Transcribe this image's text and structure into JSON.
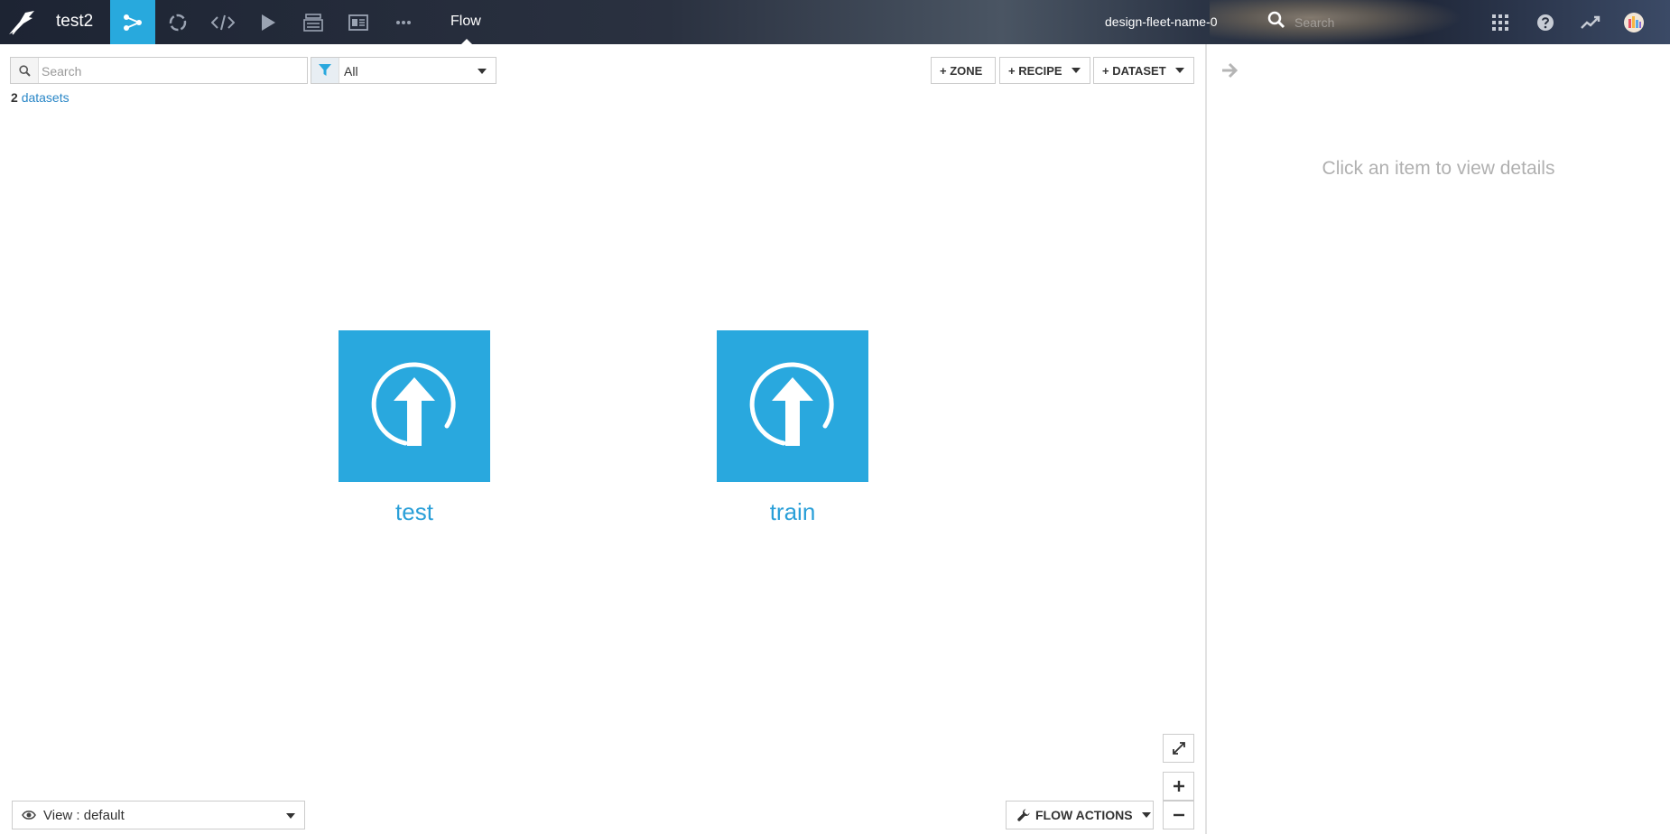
{
  "topbar": {
    "project_name": "test2",
    "current_section": "Flow",
    "instance_name": "design-fleet-name-0",
    "search_placeholder": "Search",
    "nav_icons": [
      "flow-icon",
      "lab-icon",
      "code-icon",
      "run-icon",
      "stack-icon",
      "dashboard-icon",
      "more-icon"
    ]
  },
  "toolbar": {
    "search_placeholder": "Search",
    "filter_value": "All",
    "count": "2",
    "count_label": "datasets",
    "zone_label": "+ ZONE",
    "recipe_label": "+ RECIPE",
    "dataset_label": "+ DATASET"
  },
  "flow": {
    "datasets": [
      {
        "name": "test"
      },
      {
        "name": "train"
      }
    ],
    "tile_color": "#29a8de"
  },
  "bottom": {
    "view_label": "View : default",
    "flow_actions_label": "FLOW ACTIONS"
  },
  "right_panel": {
    "hint": "Click an item to view details"
  },
  "colors": {
    "accent": "#28a9dd",
    "link": "#2a87c7"
  }
}
